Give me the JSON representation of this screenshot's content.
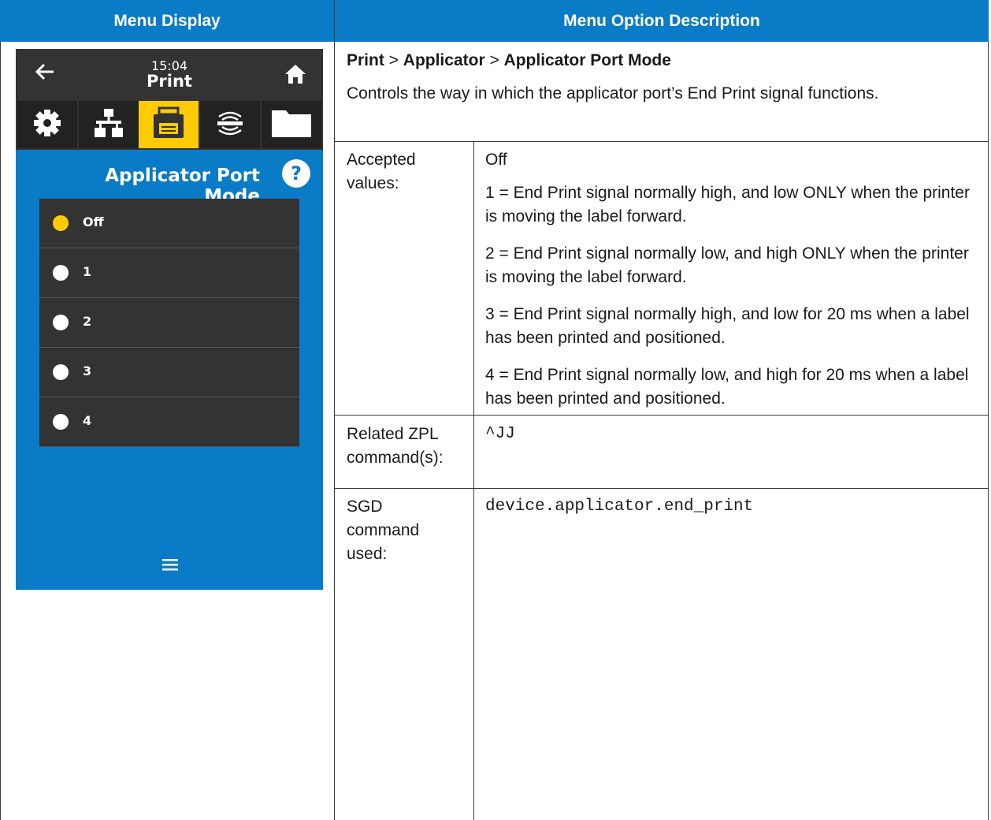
{
  "header": {
    "left": "Menu Display",
    "right": "Menu Option Description"
  },
  "device": {
    "time": "15:04",
    "title": "Print",
    "heading": "Applicator Port Mode",
    "help_glyph": "?",
    "options": [
      {
        "label": "Off",
        "selected": true
      },
      {
        "label": "1",
        "selected": false
      },
      {
        "label": "2",
        "selected": false
      },
      {
        "label": "3",
        "selected": false
      },
      {
        "label": "4",
        "selected": false
      }
    ],
    "colors": {
      "panel": "#0a7bc6",
      "bar": "#333333",
      "accent": "#ffcb05"
    },
    "icons": [
      "back-arrow-icon",
      "home-icon",
      "settings-gear-icon",
      "network-icon",
      "printer-icon",
      "rfid-icon",
      "folder-icon",
      "help-icon",
      "menu-icon"
    ]
  },
  "description": {
    "path": {
      "a": "Print",
      "sep1": " > ",
      "b": "Applicator",
      "sep2": " > ",
      "c": "Applicator Port Mode"
    },
    "intro": "Controls the way in which the applicator port’s End Print signal functions.",
    "accepted_label": "Accepted values:",
    "accepted_values": [
      "Off",
      "1 = End Print signal normally high, and low ONLY when the printer is moving the label forward.",
      "2 = End Print signal normally low, and high ONLY when the printer is moving the label forward.",
      "3 = End Print signal normally high, and low for 20 ms when a label has been printed and positioned.",
      "4 = End Print signal normally low, and high for 20 ms when a label has been printed and positioned."
    ],
    "zpl_label": "Related ZPL command(s):",
    "zpl_value": "^JJ",
    "sgd_label": "SGD command used:",
    "sgd_value": "device.applicator.end_print"
  }
}
